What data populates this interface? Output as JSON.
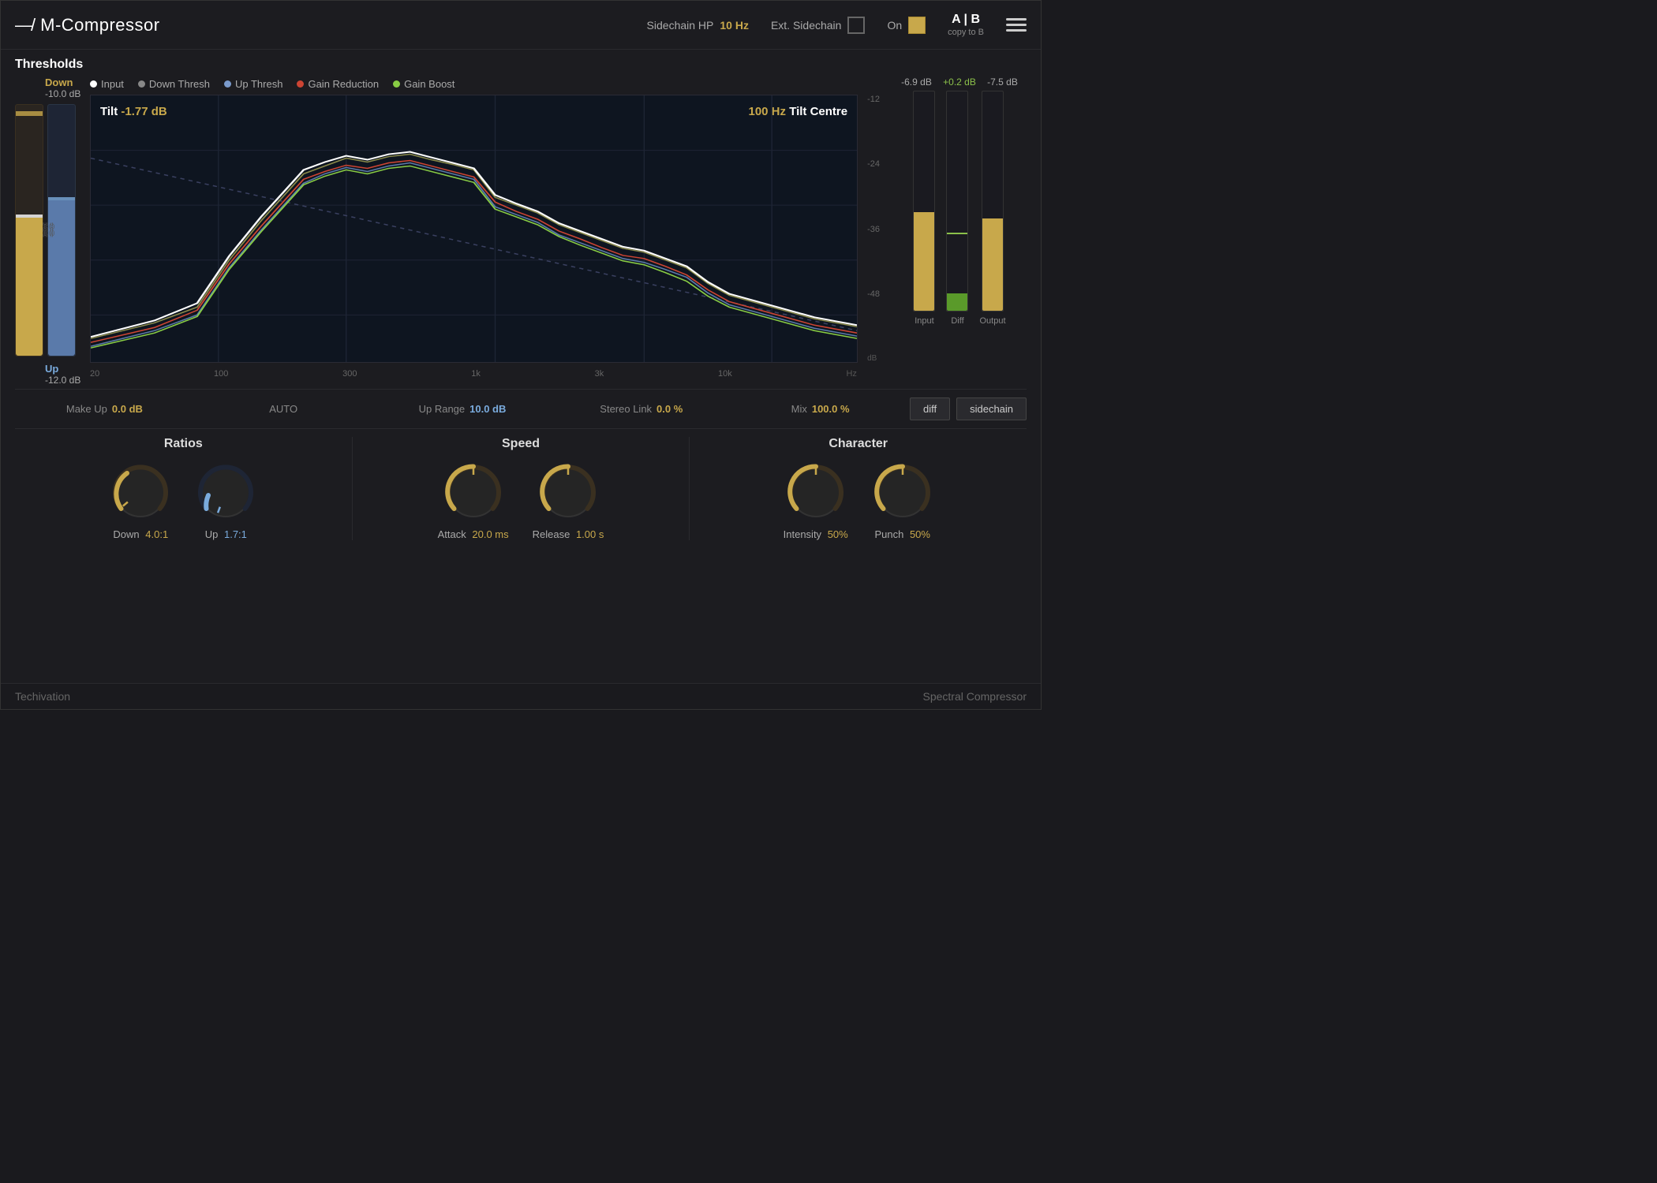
{
  "header": {
    "logo": "—/",
    "title": "M-Compressor",
    "sidechain_hp_label": "Sidechain HP",
    "sidechain_hp_value": "10 Hz",
    "ext_sidechain_label": "Ext. Sidechain",
    "on_label": "On",
    "ab_label": "A | B",
    "ab_sublabel": "copy to B"
  },
  "thresholds": {
    "section_label": "Thresholds",
    "down_label": "Down",
    "down_value": "-10.0 dB",
    "up_label": "Up",
    "up_value": "-12.0 dB",
    "tilt_label": "Tilt",
    "tilt_value": "-1.77 dB",
    "tilt_centre_value": "100 Hz",
    "tilt_centre_label": "Tilt Centre"
  },
  "legend": {
    "items": [
      {
        "label": "Input",
        "color": "#ffffff"
      },
      {
        "label": "Down Thresh",
        "color": "#999999"
      },
      {
        "label": "Up Thresh",
        "color": "#7a9acc"
      },
      {
        "label": "Gain Reduction",
        "color": "#cc4433"
      },
      {
        "label": "Gain Boost",
        "color": "#88cc44"
      }
    ]
  },
  "db_labels": [
    "-12",
    "-24",
    "-36",
    "-48"
  ],
  "freq_labels": [
    "20",
    "100",
    "300",
    "1k",
    "3k",
    "10k",
    "Hz"
  ],
  "vu_meters": {
    "input_label": "Input",
    "diff_label": "Diff",
    "output_label": "Output",
    "input_val": "-6.9 dB",
    "diff_val": "+0.2 dB",
    "output_val": "-7.5 dB"
  },
  "bottom_controls": {
    "makeup_label": "Make Up",
    "makeup_val": "0.0 dB",
    "auto_label": "AUTO",
    "up_range_label": "Up Range",
    "up_range_val": "10.0 dB",
    "stereo_link_label": "Stereo Link",
    "stereo_link_val": "0.0 %",
    "mix_label": "Mix",
    "mix_val": "100.0 %",
    "diff_btn": "diff",
    "sidechain_btn": "sidechain"
  },
  "ratios": {
    "title": "Ratios",
    "down_label": "Down",
    "down_val": "4.0:1",
    "up_label": "Up",
    "up_val": "1.7:1"
  },
  "speed": {
    "title": "Speed",
    "attack_label": "Attack",
    "attack_val": "20.0 ms",
    "release_label": "Release",
    "release_val": "1.00 s"
  },
  "character": {
    "title": "Character",
    "intensity_label": "Intensity",
    "intensity_val": "50%",
    "punch_label": "Punch",
    "punch_val": "50%"
  },
  "footer": {
    "brand": "Techivation",
    "product": "Spectral Compressor"
  }
}
